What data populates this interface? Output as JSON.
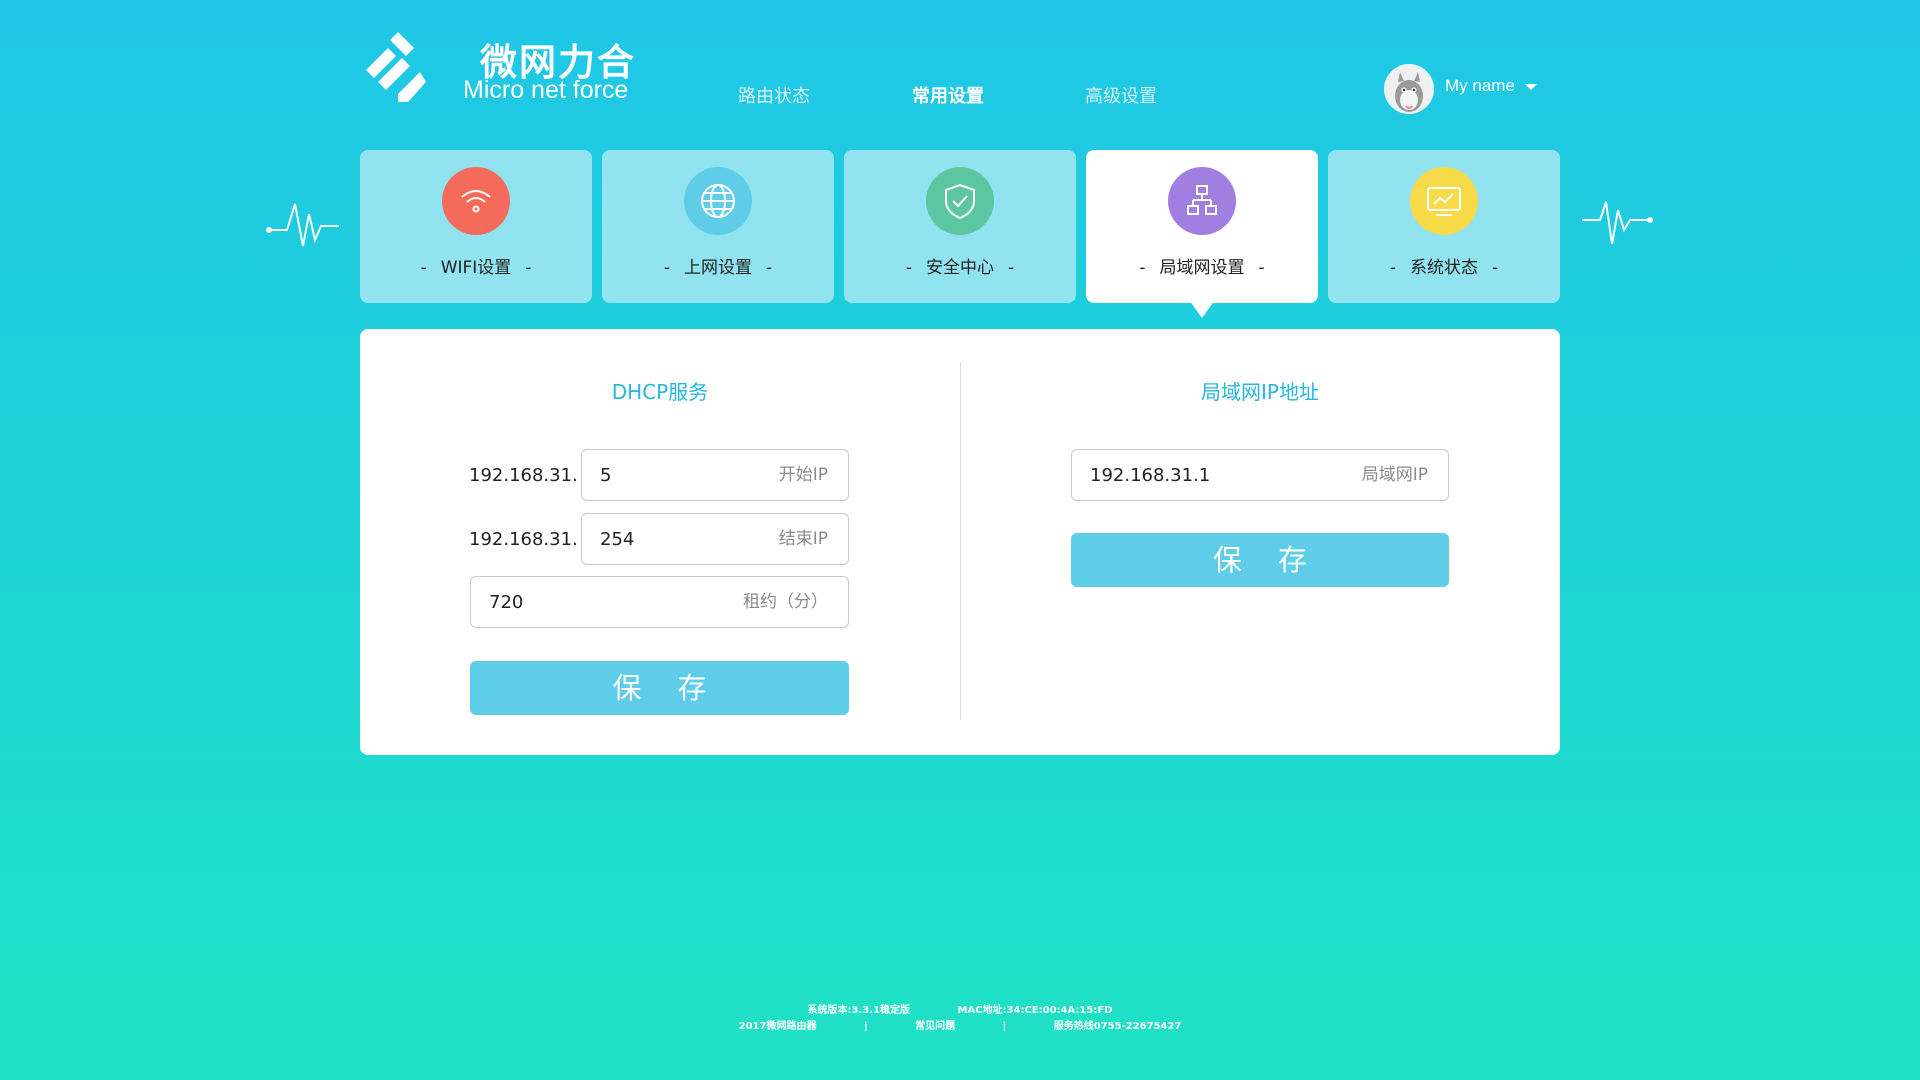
{
  "brand": {
    "name_cn": "微网力合",
    "name_en": "Micro net force"
  },
  "nav": [
    {
      "label": "路由状态",
      "active": false
    },
    {
      "label": "常用设置",
      "active": true
    },
    {
      "label": "高级设置",
      "active": false
    }
  ],
  "user": {
    "name": "My name"
  },
  "tiles": [
    {
      "label": "WIFI设置",
      "icon": "wifi-icon",
      "color": "#f46b5b",
      "active": false
    },
    {
      "label": "上网设置",
      "icon": "globe-icon",
      "color": "#5fcde8",
      "active": false
    },
    {
      "label": "安全中心",
      "icon": "shield-icon",
      "color": "#5cc6a3",
      "active": false
    },
    {
      "label": "局域网设置",
      "icon": "network-icon",
      "color": "#a07fe0",
      "active": true
    },
    {
      "label": "系统状态",
      "icon": "monitor-icon",
      "color": "#f8d948",
      "active": false
    }
  ],
  "dhcp": {
    "title": "DHCP服务",
    "ip_prefix": "192.168.31.",
    "start": {
      "value": "5",
      "hint": "开始IP"
    },
    "end": {
      "value": "254",
      "hint": "结束IP"
    },
    "lease": {
      "value": "720",
      "hint": "租约（分）"
    },
    "save_label": "保存"
  },
  "lan": {
    "title": "局域网IP地址",
    "ip": {
      "value": "192.168.31.1",
      "hint": "局域网IP"
    },
    "save_label": "保存"
  },
  "footer": {
    "version": "系统版本:3.3.1稳定版",
    "mac": "MAC地址:34:CE:00:4A:15:FD",
    "copyright": "2017微网路由器",
    "faq": "常见问题",
    "hotline": "服务热线0755-22675427",
    "sep": "|"
  },
  "colors": {
    "accent": "#26b7df",
    "button": "#5ecde9",
    "tile": "#91e4ef"
  }
}
